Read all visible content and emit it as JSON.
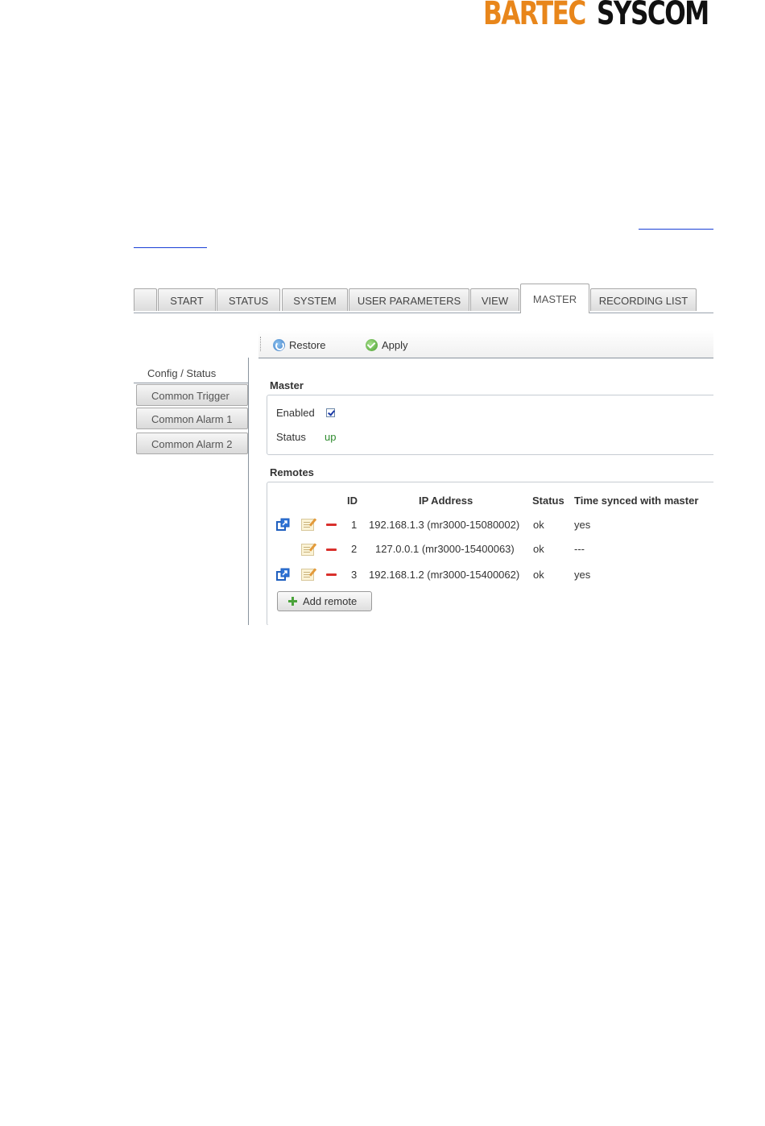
{
  "logo": {
    "part1": "BARTEC",
    "part2": "SYSCOM"
  },
  "tabs": [
    "",
    "START",
    "STATUS",
    "SYSTEM",
    "USER PARAMETERS",
    "VIEW",
    "MASTER",
    "RECORDING LIST"
  ],
  "active_tab": "MASTER",
  "toolbar": {
    "restore_label": "Restore",
    "apply_label": "Apply"
  },
  "sidebar": {
    "active": "Config / Status",
    "items": [
      "Common Trigger",
      "Common Alarm 1",
      "Common Alarm 2"
    ]
  },
  "master": {
    "title": "Master",
    "enabled_label": "Enabled",
    "enabled": true,
    "status_label": "Status",
    "status_value": "up"
  },
  "remotes": {
    "title": "Remotes",
    "columns": [
      "ID",
      "IP Address",
      "Status",
      "Time synced with master"
    ],
    "rows": [
      {
        "id": "1",
        "ip": "192.168.1.3 (mr3000-15080002)",
        "status": "ok",
        "synced": "yes",
        "has_open": true
      },
      {
        "id": "2",
        "ip": "127.0.0.1 (mr3000-15400063)",
        "status": "ok",
        "synced": "---",
        "has_open": false
      },
      {
        "id": "3",
        "ip": "192.168.1.2 (mr3000-15400062)",
        "status": "ok",
        "synced": "yes",
        "has_open": true
      }
    ],
    "add_label": "Add remote"
  }
}
